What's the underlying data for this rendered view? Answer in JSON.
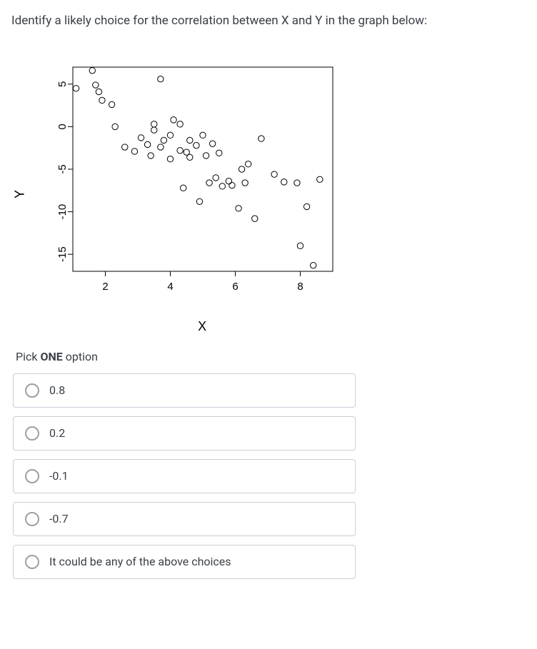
{
  "question": "Identify a likely choice for the correlation between X and Y in the graph below:",
  "prompt_prefix": "Pick ",
  "prompt_bold": "ONE",
  "prompt_suffix": " option",
  "options": [
    {
      "label": "0.8"
    },
    {
      "label": "0.2"
    },
    {
      "label": "-0.1"
    },
    {
      "label": "-0.7"
    },
    {
      "label": "It could be any of the above choices"
    }
  ],
  "chart_data": {
    "type": "scatter",
    "xlabel": "X",
    "ylabel": "Y",
    "xlim": [
      1,
      9
    ],
    "ylim": [
      -17,
      7
    ],
    "x_ticks": [
      2,
      4,
      6,
      8
    ],
    "y_ticks": [
      -15,
      -10,
      -5,
      0,
      5
    ],
    "data": [
      {
        "x": 1.1,
        "y": 4.5
      },
      {
        "x": 1.6,
        "y": 6.6
      },
      {
        "x": 1.7,
        "y": 4.9
      },
      {
        "x": 1.8,
        "y": 4.1
      },
      {
        "x": 1.9,
        "y": 3.1
      },
      {
        "x": 2.2,
        "y": 2.6
      },
      {
        "x": 2.3,
        "y": 0.0
      },
      {
        "x": 2.6,
        "y": -2.4
      },
      {
        "x": 2.9,
        "y": -2.9
      },
      {
        "x": 3.1,
        "y": -1.3
      },
      {
        "x": 3.3,
        "y": -2.1
      },
      {
        "x": 3.4,
        "y": -3.4
      },
      {
        "x": 3.5,
        "y": 0.3
      },
      {
        "x": 3.5,
        "y": -0.4
      },
      {
        "x": 3.7,
        "y": 5.6
      },
      {
        "x": 3.7,
        "y": -2.4
      },
      {
        "x": 3.8,
        "y": -1.6
      },
      {
        "x": 4.0,
        "y": -3.8
      },
      {
        "x": 4.0,
        "y": -1.0
      },
      {
        "x": 4.1,
        "y": 0.8
      },
      {
        "x": 4.3,
        "y": -2.8
      },
      {
        "x": 4.3,
        "y": 0.3
      },
      {
        "x": 4.4,
        "y": -7.2
      },
      {
        "x": 4.5,
        "y": -3.0
      },
      {
        "x": 4.6,
        "y": -1.6
      },
      {
        "x": 4.6,
        "y": -3.6
      },
      {
        "x": 4.8,
        "y": -2.2
      },
      {
        "x": 4.9,
        "y": -8.8
      },
      {
        "x": 5.0,
        "y": -1.0
      },
      {
        "x": 5.1,
        "y": -3.4
      },
      {
        "x": 5.2,
        "y": -6.6
      },
      {
        "x": 5.3,
        "y": -2.0
      },
      {
        "x": 5.4,
        "y": -6.0
      },
      {
        "x": 5.5,
        "y": -3.1
      },
      {
        "x": 5.6,
        "y": -7.0
      },
      {
        "x": 5.8,
        "y": -6.4
      },
      {
        "x": 5.9,
        "y": -6.9
      },
      {
        "x": 6.2,
        "y": -5.0
      },
      {
        "x": 6.3,
        "y": -6.6
      },
      {
        "x": 6.1,
        "y": -9.6
      },
      {
        "x": 6.4,
        "y": -4.4
      },
      {
        "x": 6.6,
        "y": -10.8
      },
      {
        "x": 6.8,
        "y": -1.4
      },
      {
        "x": 7.2,
        "y": -5.6
      },
      {
        "x": 7.5,
        "y": -6.5
      },
      {
        "x": 7.9,
        "y": -6.6
      },
      {
        "x": 8.0,
        "y": -14.0
      },
      {
        "x": 8.2,
        "y": -9.4
      },
      {
        "x": 8.4,
        "y": -16.3
      },
      {
        "x": 8.6,
        "y": -6.2
      }
    ]
  }
}
